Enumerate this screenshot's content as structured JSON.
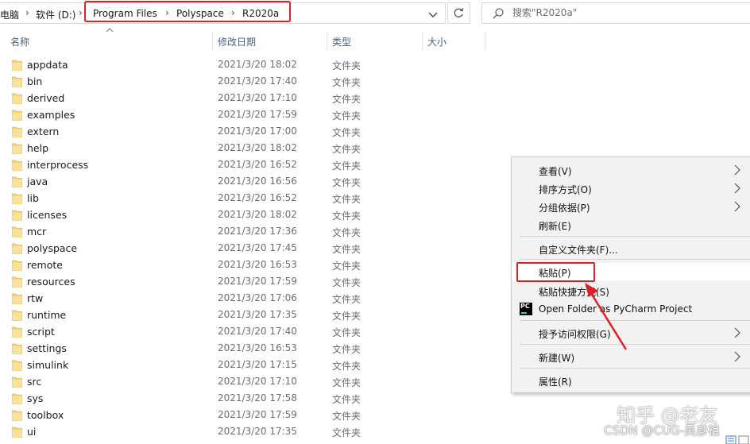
{
  "address_bar": {
    "breadcrumbs": [
      "电脑",
      "软件 (D:)",
      "Program Files",
      "Polyspace",
      "R2020a"
    ],
    "separator": "›"
  },
  "search": {
    "placeholder": "搜索\"R2020a\""
  },
  "columns": {
    "name": "名称",
    "date_modified": "修改日期",
    "type": "类型",
    "size": "大小"
  },
  "files": [
    {
      "name": "appdata",
      "date": "2021/3/20 18:02",
      "type": "文件夹"
    },
    {
      "name": "bin",
      "date": "2021/3/20 17:40",
      "type": "文件夹"
    },
    {
      "name": "derived",
      "date": "2021/3/20 17:10",
      "type": "文件夹"
    },
    {
      "name": "examples",
      "date": "2021/3/20 17:59",
      "type": "文件夹"
    },
    {
      "name": "extern",
      "date": "2021/3/20 17:00",
      "type": "文件夹"
    },
    {
      "name": "help",
      "date": "2021/3/20 18:02",
      "type": "文件夹"
    },
    {
      "name": "interprocess",
      "date": "2021/3/20 16:52",
      "type": "文件夹"
    },
    {
      "name": "java",
      "date": "2021/3/20 16:56",
      "type": "文件夹"
    },
    {
      "name": "lib",
      "date": "2021/3/20 16:52",
      "type": "文件夹"
    },
    {
      "name": "licenses",
      "date": "2021/3/20 18:02",
      "type": "文件夹"
    },
    {
      "name": "mcr",
      "date": "2021/3/20 17:36",
      "type": "文件夹"
    },
    {
      "name": "polyspace",
      "date": "2021/3/20 17:45",
      "type": "文件夹"
    },
    {
      "name": "remote",
      "date": "2021/3/20 16:53",
      "type": "文件夹"
    },
    {
      "name": "resources",
      "date": "2021/3/20 17:59",
      "type": "文件夹"
    },
    {
      "name": "rtw",
      "date": "2021/3/20 17:06",
      "type": "文件夹"
    },
    {
      "name": "runtime",
      "date": "2021/3/20 17:35",
      "type": "文件夹"
    },
    {
      "name": "script",
      "date": "2021/3/20 17:40",
      "type": "文件夹"
    },
    {
      "name": "settings",
      "date": "2021/3/20 16:53",
      "type": "文件夹"
    },
    {
      "name": "simulink",
      "date": "2021/3/20 17:15",
      "type": "文件夹"
    },
    {
      "name": "src",
      "date": "2021/3/20 17:10",
      "type": "文件夹"
    },
    {
      "name": "sys",
      "date": "2021/3/20 17:58",
      "type": "文件夹"
    },
    {
      "name": "toolbox",
      "date": "2021/3/20 17:59",
      "type": "文件夹"
    },
    {
      "name": "ui",
      "date": "2021/3/20 17:35",
      "type": "文件夹"
    }
  ],
  "context_menu": {
    "view": "查看(V)",
    "sort_by": "排序方式(O)",
    "group_by": "分组依据(P)",
    "refresh": "刷新(E)",
    "customize_folder": "自定义文件夹(F)...",
    "paste": "粘贴(P)",
    "paste_shortcut": "粘贴快捷方式(S)",
    "open_pycharm": "Open Folder as PyCharm Project",
    "give_access": "授予访问权限(G)",
    "new": "新建(W)",
    "properties": "属性(R)",
    "pycharm_icon_text": "PC"
  },
  "watermarks": {
    "zhihu": "知乎 @老友",
    "csdn": "CSDN @CUG-吴彦祖"
  },
  "colors": {
    "highlight_red": "#e02020",
    "folder_yellow": "#f8d775",
    "header_text": "#4c607a"
  }
}
